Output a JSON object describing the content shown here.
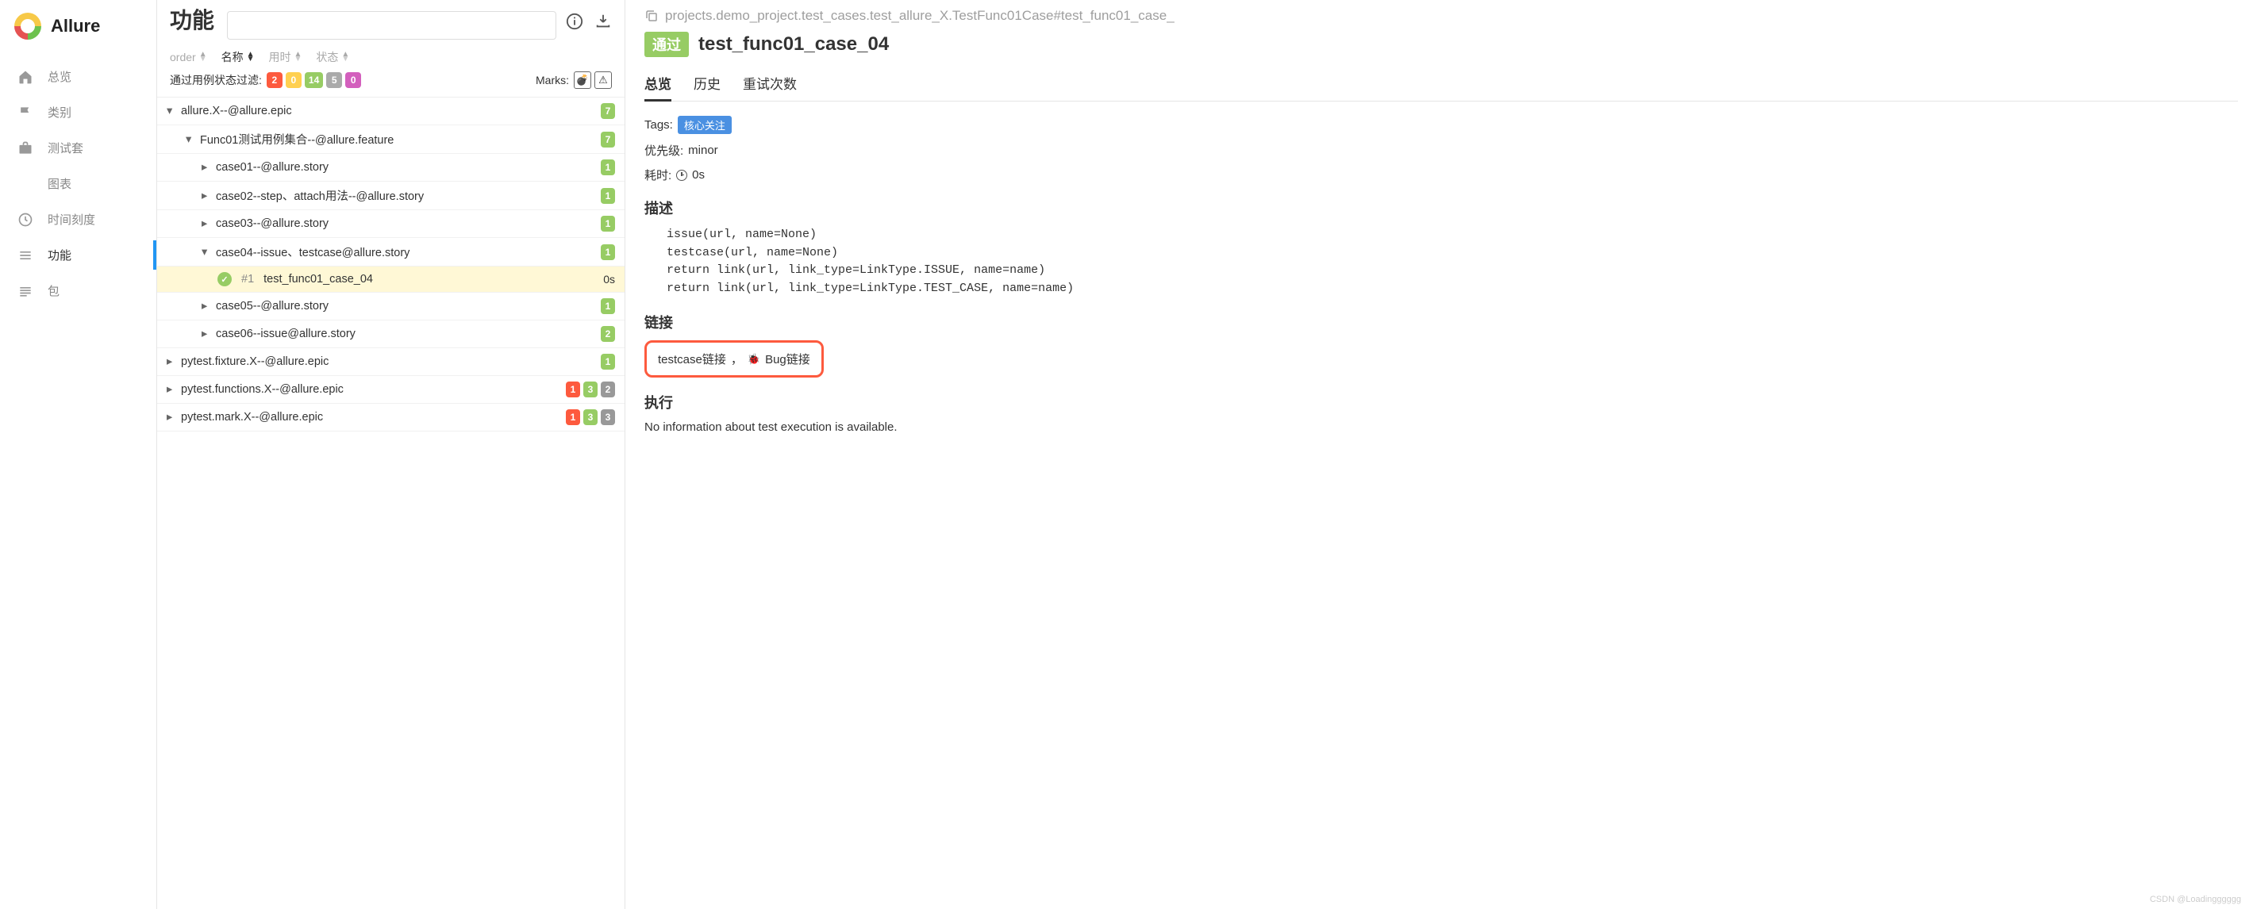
{
  "brand": "Allure",
  "sidebar": {
    "items": [
      {
        "icon": "home",
        "label": "总览"
      },
      {
        "icon": "flag",
        "label": "类别"
      },
      {
        "icon": "briefcase",
        "label": "测试套"
      },
      {
        "icon": "chart",
        "label": "图表"
      },
      {
        "icon": "clock",
        "label": "时间刻度"
      },
      {
        "icon": "list",
        "label": "功能"
      },
      {
        "icon": "stack",
        "label": "包"
      }
    ]
  },
  "middle": {
    "title": "功能",
    "search_placeholder": "",
    "sort_cols": [
      {
        "label": "order",
        "active": false
      },
      {
        "label": "名称",
        "active": true
      },
      {
        "label": "用时",
        "active": false
      },
      {
        "label": "状态",
        "active": false
      }
    ],
    "filter_label": "通过用例状态过滤:",
    "filter_counts": [
      {
        "cls": "bred",
        "val": "2"
      },
      {
        "cls": "byellow",
        "val": "0"
      },
      {
        "cls": "bgreen",
        "val": "14"
      },
      {
        "cls": "bgraymid",
        "val": "5"
      },
      {
        "cls": "bpurple",
        "val": "0"
      }
    ],
    "marks_label": "Marks:",
    "tree": [
      {
        "depth": 0,
        "open": true,
        "title": "allure.X--@allure.epic",
        "badges": [
          {
            "cls": "bgreen",
            "val": "7"
          }
        ]
      },
      {
        "depth": 1,
        "open": true,
        "title": "Func01测试用例集合--@allure.feature",
        "badges": [
          {
            "cls": "bgreen",
            "val": "7"
          }
        ]
      },
      {
        "depth": 2,
        "open": false,
        "title": "case01--@allure.story",
        "badges": [
          {
            "cls": "bgreen",
            "val": "1"
          }
        ]
      },
      {
        "depth": 2,
        "open": false,
        "title": "case02--step、attach用法--@allure.story",
        "badges": [
          {
            "cls": "bgreen",
            "val": "1"
          }
        ]
      },
      {
        "depth": 2,
        "open": false,
        "title": "case03--@allure.story",
        "badges": [
          {
            "cls": "bgreen",
            "val": "1"
          }
        ]
      },
      {
        "depth": 2,
        "open": true,
        "title": "case04--issue、testcase@allure.story",
        "badges": [
          {
            "cls": "bgreen",
            "val": "1"
          }
        ]
      },
      {
        "depth": 3,
        "leaf": true,
        "selected": true,
        "num": "#1",
        "title": "test_func01_case_04",
        "duration": "0s"
      },
      {
        "depth": 2,
        "open": false,
        "title": "case05--@allure.story",
        "badges": [
          {
            "cls": "bgreen",
            "val": "1"
          }
        ]
      },
      {
        "depth": 2,
        "open": false,
        "title": "case06--issue@allure.story",
        "badges": [
          {
            "cls": "bgreen",
            "val": "2"
          }
        ]
      },
      {
        "depth": 0,
        "open": false,
        "title": "pytest.fixture.X--@allure.epic",
        "badges": [
          {
            "cls": "bgreen",
            "val": "1"
          }
        ]
      },
      {
        "depth": 0,
        "open": false,
        "title": "pytest.functions.X--@allure.epic",
        "badges": [
          {
            "cls": "bred",
            "val": "1"
          },
          {
            "cls": "bgreen",
            "val": "3"
          },
          {
            "cls": "bgray",
            "val": "2"
          }
        ]
      },
      {
        "depth": 0,
        "open": false,
        "title": "pytest.mark.X--@allure.epic",
        "badges": [
          {
            "cls": "bred",
            "val": "1"
          },
          {
            "cls": "bgreen",
            "val": "3"
          },
          {
            "cls": "bgray",
            "val": "3"
          }
        ]
      }
    ]
  },
  "detail": {
    "crumb": "projects.demo_project.test_cases.test_allure_X.TestFunc01Case#test_func01_case_",
    "status": "通过",
    "title": "test_func01_case_04",
    "tabs": [
      "总览",
      "历史",
      "重试次数"
    ],
    "tags_label": "Tags:",
    "tag": "核心关注",
    "priority_label": "优先级:",
    "priority": "minor",
    "duration_label": "耗时:",
    "duration": "0s",
    "desc_h": "描述",
    "desc_code": "issue(url, name=None)\ntestcase(url, name=None)\nreturn link(url, link_type=LinkType.ISSUE, name=name)\nreturn link(url, link_type=LinkType.TEST_CASE, name=name)",
    "links_h": "链接",
    "link_testcase": "testcase链接",
    "link_sep": "，",
    "link_bug": "Bug链接",
    "exec_h": "执行",
    "exec_text": "No information about test execution is available."
  },
  "watermark": "CSDN @Loadingggggg"
}
